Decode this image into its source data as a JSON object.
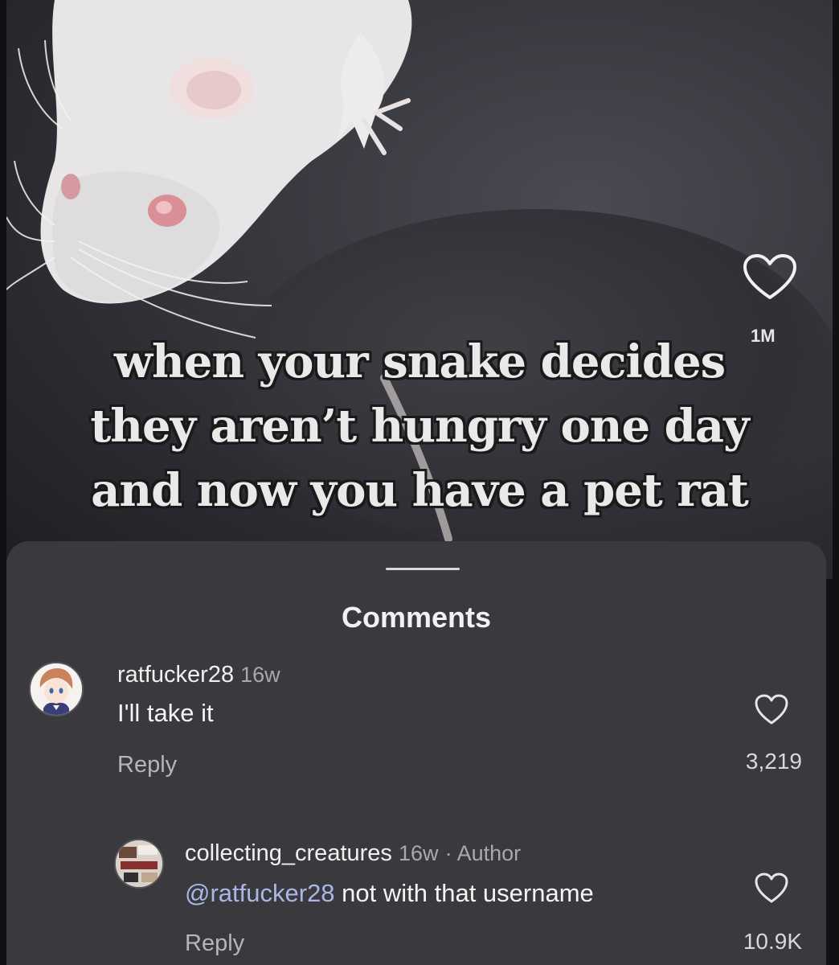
{
  "video": {
    "caption_lines": [
      "when your snake decides",
      "they aren’t hungry one day",
      "and now you have a pet rat"
    ],
    "like_icon": "heart-icon",
    "like_count": "1M"
  },
  "comments_sheet": {
    "title": "Comments",
    "comments": [
      {
        "username": "ratfucker28",
        "time": "16w",
        "text": "I'll take it",
        "reply_label": "Reply",
        "like_icon": "heart-icon",
        "likes": "3,219"
      },
      {
        "username": "collecting_creatures",
        "time": "16w",
        "author_tag": "· Author",
        "mention": "@ratfucker28",
        "text": " not with that username",
        "reply_label": "Reply",
        "like_icon": "heart-icon",
        "likes": "10.9K"
      }
    ]
  },
  "colors": {
    "sheet_background": "#3a3a3e",
    "mention": "#a9b7e6",
    "text_primary": "#f2f2f2",
    "text_secondary": "#b5b5ba"
  }
}
